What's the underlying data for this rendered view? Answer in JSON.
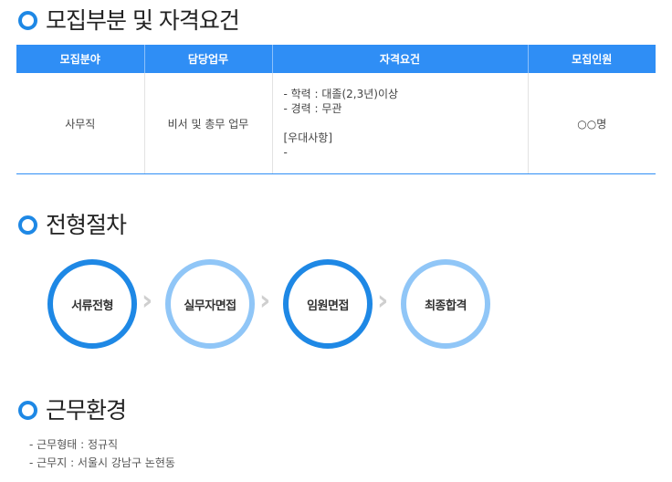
{
  "sections": {
    "recruit_title": "모집부분 및 자격요건",
    "process_title": "전형절차",
    "environment_title": "근무환경"
  },
  "recruit_table": {
    "headers": [
      "모집분야",
      "담당업무",
      "자격요건",
      "모집인원"
    ],
    "row": {
      "field": "사무직",
      "duty": "비서 및 총무 업무",
      "qualifications": [
        "- 학력 : 대졸(2,3년)이상",
        "- 경력 : 무관"
      ],
      "preferred_label": "[우대사항]",
      "preferred_items": [
        "-"
      ],
      "headcount": "○○명"
    }
  },
  "process": {
    "steps": [
      {
        "label": "서류전형",
        "style": "dark"
      },
      {
        "label": "실무자면접",
        "style": "light"
      },
      {
        "label": "임원면접",
        "style": "dark"
      },
      {
        "label": "최종합격",
        "style": "light"
      }
    ],
    "arrow_glyph": "›"
  },
  "environment": {
    "items": [
      "- 근무형태 : 정규직",
      "- 근무지 : 서울시 강남구 논현동"
    ]
  },
  "colors": {
    "accent": "#2f8ef5",
    "step_dark": "#1e88e5",
    "step_light": "#90c6f7"
  }
}
